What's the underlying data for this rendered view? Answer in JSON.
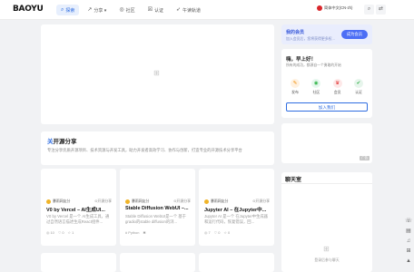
{
  "header": {
    "logo": "BAOYU",
    "nav": [
      {
        "icon": "search-icon",
        "glyph": "⌕",
        "label": "探索",
        "active": true
      },
      {
        "icon": "share-icon",
        "glyph": "↗",
        "label": "分享 ▾",
        "active": false
      },
      {
        "icon": "community-icon",
        "glyph": "◎",
        "label": "社区",
        "active": false
      },
      {
        "icon": "certify-icon",
        "glyph": "☒",
        "label": "认证",
        "active": false
      },
      {
        "icon": "rocket-icon",
        "glyph": "➶",
        "label": "午读轨道",
        "active": false
      }
    ],
    "language": "简体中文(CN-zh)",
    "icon_search": "⌕",
    "icon_settings": "⇄"
  },
  "intro": {
    "title_prefix": "关",
    "title_rest": "开源分享",
    "desc": "专注分享优质开源项目、技术资源与开发工具，助力开发者高效学习、协作与创新，打造专业的开源技术分享平台"
  },
  "posts": [
    {
      "author": "暴雨网友分",
      "tag": "⊙开源分享",
      "title": "V0 by Vercel – AI生成UI...",
      "desc": "V0 by Vercel 是一个 AI生成工具，通过自然语言描述生成React组件...",
      "stats": [
        "◎ 10",
        "♡ 0",
        "☆ 1"
      ]
    },
    {
      "author": "暴雨网友分",
      "tag": "⊙开源分享",
      "title": "Stable Diffusion WebUI –...",
      "desc": "Stable Diffusion WebUI是一个 基于gradio的stable diffusion的浏...",
      "stats": [
        "# Python",
        "✱"
      ]
    },
    {
      "author": "暴雨网友分",
      "tag": "⊙开源分享",
      "title": "Jupyter AI – 在Jupyter中...",
      "desc": "Jupyter AI 是一个 在Jupyter中生成器和运行代码，恢复错误，回...",
      "stats": [
        "◎ 7",
        "♡ 0",
        "☆ 0"
      ]
    }
  ],
  "sidebar": {
    "member": {
      "title": "我的会员",
      "sub": "加入会员后，您将获得更多权...",
      "button": "成为会员"
    },
    "user": {
      "greeting": "嗨，早上好！",
      "sub": "所有的成功，都源自一个勇敢的开始",
      "quick": [
        {
          "icon": "post-icon",
          "glyph": "✎",
          "label": "发布",
          "bg": "#fff1e0",
          "color": "#f08c00"
        },
        {
          "icon": "community-icon",
          "glyph": "◉",
          "label": "社区",
          "bg": "#e6f7ee",
          "color": "#2fb344"
        },
        {
          "icon": "member-icon",
          "glyph": "♛",
          "label": "会员",
          "bg": "#fde8e8",
          "color": "#e03131"
        },
        {
          "icon": "certify-icon",
          "glyph": "✔",
          "label": "认证",
          "bg": "#e7f5ec",
          "color": "#37b24d"
        }
      ],
      "join": "加入我们"
    },
    "ad_tag": "广告",
    "chat": {
      "title": "聊天室",
      "empty": "登录后参与聊天"
    }
  },
  "rail": [
    "☏",
    "▤",
    "♫",
    "⊞",
    "▲"
  ]
}
